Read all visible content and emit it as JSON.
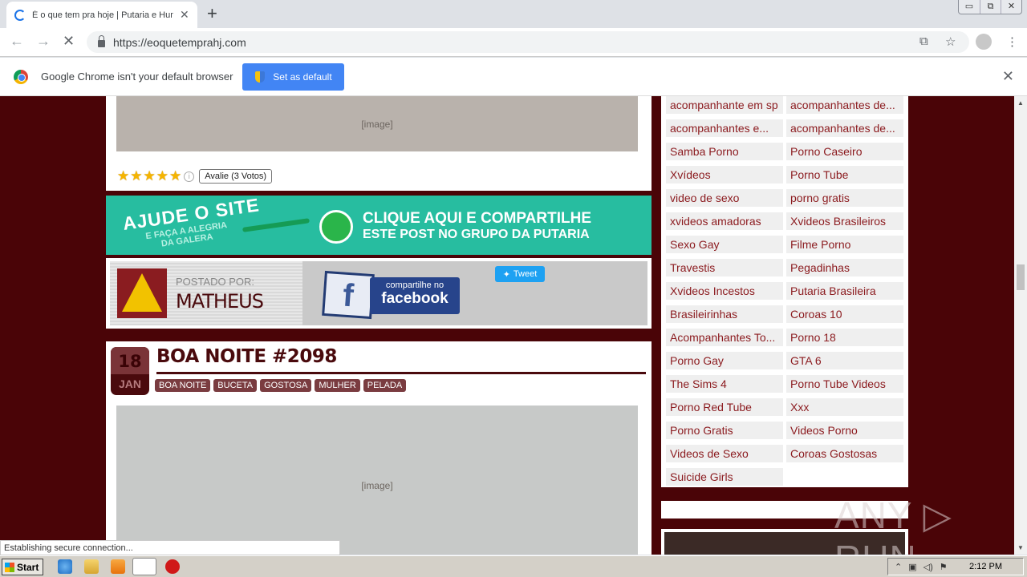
{
  "browser": {
    "tab_title": "É o que tem pra hoje | Putaria e Humor",
    "new_tab_label": "+",
    "url": "https://eoquetemprahj.com",
    "window_controls": {
      "minimize": "▭",
      "restore": "⧉",
      "close": "✕"
    },
    "infobar": {
      "message": "Google Chrome isn't your default browser",
      "set_default_label": "Set as default",
      "close_label": "✕"
    },
    "status_text": "Establishing secure connection..."
  },
  "page": {
    "rating": {
      "stars": 5,
      "max_stars": 5,
      "votes_label": "Avalie (3 Votos)"
    },
    "whatsapp_banner": {
      "left_big": "AJUDE O SITE",
      "left_small_1": "E FAÇA A ALEGRIA",
      "left_small_2": "DA GALERA",
      "right_line_1": "CLIQUE AQUI E COMPARTILHE",
      "right_line_2": "ESTE POST NO GRUPO DA PUTARIA"
    },
    "author_box": {
      "posted_by_label": "POSTADO POR:",
      "author_name": "MATHEUS",
      "facebook_small": "compartilhe no",
      "facebook_big": "facebook",
      "facebook_glyph": "f",
      "tweet_label": "Tweet"
    },
    "post": {
      "day": "18",
      "month": "JAN",
      "title": "BOA NOITE #2098",
      "tags": [
        "BOA NOITE",
        "BUCETA",
        "GOSTOSA",
        "MULHER",
        "PELADA"
      ],
      "image_placeholder": "[image]"
    },
    "sidebar": {
      "tag_cloud": [
        "acompanhante em sp",
        "acompanhantes de...",
        "acompanhantes e...",
        "acompanhantes de...",
        "Samba Porno",
        "Porno Caseiro",
        "Xvídeos",
        "Porno Tube",
        "video de sexo",
        "porno gratis",
        "xvideos amadoras",
        "Xvideos Brasileiros",
        "Sexo Gay",
        "Filme Porno",
        "Travestis",
        "Pegadinhas",
        "Xvideos Incestos",
        "Putaria Brasileira",
        "Brasileirinhas",
        "Coroas 10",
        "Acompanhantes To...",
        "Porno 18",
        "Porno Gay",
        "GTA 6",
        "The Sims 4",
        "Porno Tube Videos",
        "Porno Red Tube",
        "Xxx",
        "Porno Gratis",
        "Videos Porno",
        "Videos de Sexo",
        "Coroas Gostosas",
        "Suicide Girls"
      ]
    },
    "watermark": "ANY ▷ RUN"
  },
  "taskbar": {
    "start_label": "Start",
    "clock": "2:12 PM"
  },
  "colors": {
    "page_background": "#4a0407",
    "accent_maroon": "#7a3c40",
    "link_red": "#8b1a1e",
    "whatsapp_teal": "#27bda0",
    "chrome_blue": "#4285f4"
  }
}
